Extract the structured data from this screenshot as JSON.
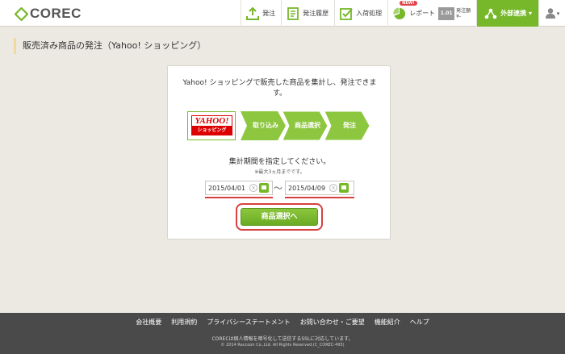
{
  "header": {
    "logo_text": "COREC",
    "nav": {
      "order": "発注",
      "history": "発注履歴",
      "receiving": "入荷処理",
      "report": "レポート",
      "report_badge": "NEW!",
      "report_bar": "1.01",
      "report_label_1": "発注額",
      "report_label_2": "¥-",
      "external": "外部連携 ▾",
      "user_caret": "▾"
    },
    "colors": {
      "accent": "#76b82a"
    }
  },
  "page": {
    "title": "販売済み商品の発注（Yahoo! ショッピング）"
  },
  "card": {
    "description": "Yahoo! ショッピングで販売した商品を集計し、発注できます。",
    "yahoo_logo_top": "YAHOO!",
    "yahoo_logo_bottom": "ショッピング",
    "steps": [
      "取り込み",
      "商品選択",
      "発注"
    ],
    "period_label": "集計期間を指定してください。",
    "period_note": "※最大3ヵ月までです。",
    "date_from": "2015/04/01",
    "date_to": "2015/04/09",
    "tilde": "〜",
    "submit_label": "商品選択へ"
  },
  "footer": {
    "links": [
      "会社概要",
      "利用規約",
      "プライバシーステートメント",
      "お問い合わせ・ご要望",
      "機能紹介",
      "ヘルプ"
    ],
    "ssl_text": "CORECは個人情報を暗号化して送信するSSLに対応しています。",
    "copyright": "© 2014 Raccoon Co.,Ltd. All Rights Reserved.(C_COREC-495)"
  }
}
